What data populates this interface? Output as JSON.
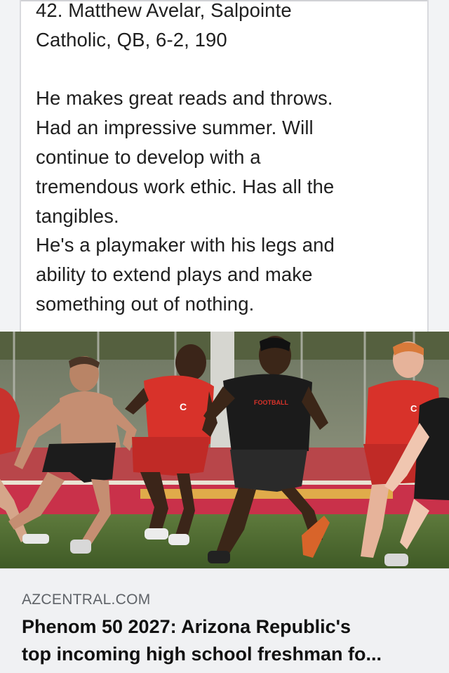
{
  "post": {
    "lines": [
      "42. Matthew Avelar, Salpointe",
      "Catholic, QB, 6-2, 190",
      "",
      "He makes great reads and throws.",
      "Had an impressive summer. Will",
      "continue to develop with a",
      "tremendous work ethic. Has all the",
      "tangibles.",
      "He's a playmaker with his legs and",
      "ability to extend plays and make",
      "something out of nothing."
    ]
  },
  "photo": {
    "jersey_letter": "C",
    "shirt_text": "FOOTBALL"
  },
  "link_card": {
    "domain": "AZCENTRAL.COM",
    "headline_line1": "Phenom 50 2027: Arizona Republic's",
    "headline_line2": "top incoming high school freshman fo..."
  },
  "colors": {
    "text": "#1f1f1f",
    "card_bg": "#f0f1f3",
    "domain_text": "#5f6368",
    "team_red": "#d8322a"
  }
}
